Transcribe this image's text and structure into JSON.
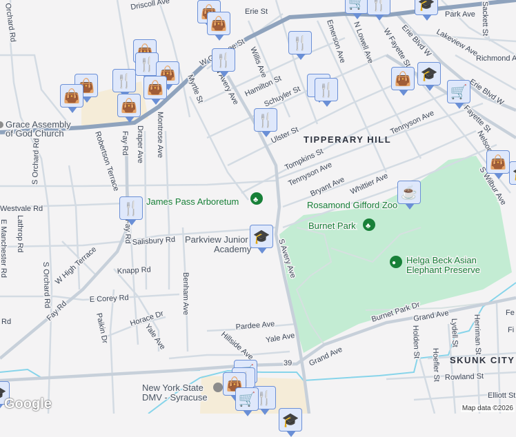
{
  "streets": {
    "driscoll": "Driscoll Ave",
    "erie_st": "Erie St",
    "w_genesee": "W Genesee St",
    "park_ave": "Park Ave",
    "sackett": "Sackett St",
    "lakeview": "Lakeview Ave",
    "richmond": "Richmond Ave",
    "erie_blvd": "Erie Blvd W",
    "erie_blvd2": "Erie Blvd W",
    "w_fayette": "W Fayette St",
    "w_fayette2": "Fayette St",
    "n_lowell": "N Lowell Ave",
    "emerson": "Emerson Ave",
    "willis": "Willis Ave",
    "hamilton": "Hamilton St",
    "schuyler": "Schuyler St",
    "ulster": "Ulster St",
    "myrtle": "Myrtle St",
    "avery": "N Avery Ave",
    "s_avery": "S Avery Ave",
    "tompkins": "Tompkins St",
    "tennyson": "Tennyson Ave",
    "tennyson2": "Tennyson Ave",
    "bryant": "Bryant Ave",
    "whittier": "Whittier Ave",
    "nelson": "Nelson St",
    "s_wilbur": "S Wilbur Ave",
    "orchard_rd": "Orchard Rd",
    "s_orchard": "S Orchard Rd",
    "s_orchard2": "S Orchard Rd",
    "robertson": "Robertson Terrace",
    "fay": "Fay Rd",
    "fay2": "Fay Rd",
    "fay3": "Fay Rd",
    "draper": "Draper Ave",
    "montrose": "Montrose Ave",
    "westvale": "Westvale Rd",
    "lathrop": "Lathrop Rd",
    "e_manchester": "E Manchester Rd",
    "salisbury": "Salisbury Rd",
    "w_high": "W High Terrace",
    "knapp": "Knapp Rd",
    "benham": "Benham Ave",
    "e_corey": "E Corey Rd",
    "paikin": "Paikin Dr",
    "horace": "Horace Dr",
    "yale": "Yale Ave",
    "yale2": "Yale Ave",
    "pardee": "Pardee Ave",
    "hillside": "Hillside Ave",
    "burnet_park_dr": "Burnet Park Dr",
    "grand": "Grand Ave",
    "grand2": "Grand Ave",
    "route39": "39",
    "holden": "Holden St",
    "hoefler": "Hoefler St",
    "lydell": "Lydell St",
    "herriman": "Herriman St",
    "rowland": "Rowland St",
    "elliott": "Elliott St",
    "fe": "Fe",
    "fi": "Fi",
    "rd_left": "Rd"
  },
  "places": {
    "grace_church": [
      "Grace Assembly",
      "of God Church"
    ],
    "arboretum": "James Pass Arboretum",
    "zoo": "Rosamond Gifford Zoo",
    "burnet_park": "Burnet Park",
    "elephant": [
      "Helga Beck Asian",
      "Elephant Preserve"
    ],
    "parkview": [
      "Parkview Junior",
      "Academy"
    ],
    "dmv": [
      "New York State",
      "DMV - Syracuse"
    ]
  },
  "neighborhoods": {
    "tipperary": "TIPPERARY HILL",
    "skunk": "SKUNK CITY"
  },
  "markers": [
    "shopping-bag",
    "restaurant",
    "school",
    "shopping-cart",
    "cafe"
  ],
  "branding": {
    "logo": "Google",
    "attribution": "Map data ©2026"
  },
  "colors": {
    "park": "#c3ecd3",
    "highway": "#8fa3bd",
    "road": "#d3dbe3",
    "water": "#86d4ea",
    "marker_fill": "#dfe8fb",
    "marker_icon": "#0b4369"
  }
}
